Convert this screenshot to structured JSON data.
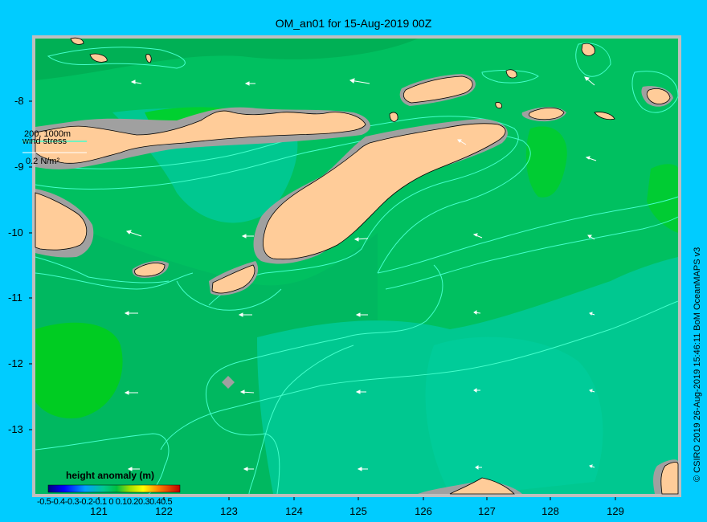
{
  "title": "OM_an01 for 15-Aug-2019 00Z",
  "credit": "© CSIRO 2019   26-Aug-2019 15:46:11 BoM OceanMAPS v3",
  "y_ticks": [
    "-8",
    "-9",
    "-10",
    "-11",
    "-12",
    "-13"
  ],
  "x_ticks": [
    "121",
    "122",
    "123",
    "124",
    "125",
    "126",
    "127",
    "128",
    "129"
  ],
  "contour_label": "200, 1000m",
  "wind_label": "wind stress",
  "wind_scale": "0.2 N/m²",
  "colorbar": {
    "title": "height anomaly (m)",
    "ticks": "-0.5-0.4-0.3-0.2-0.1 0 0.10.20.30.40.5"
  },
  "colors": {
    "background": "#00ccff",
    "land": "#ffcc99",
    "shelf": "#999999",
    "contour": "#44ffcc",
    "frame": "#c0c0c0"
  }
}
